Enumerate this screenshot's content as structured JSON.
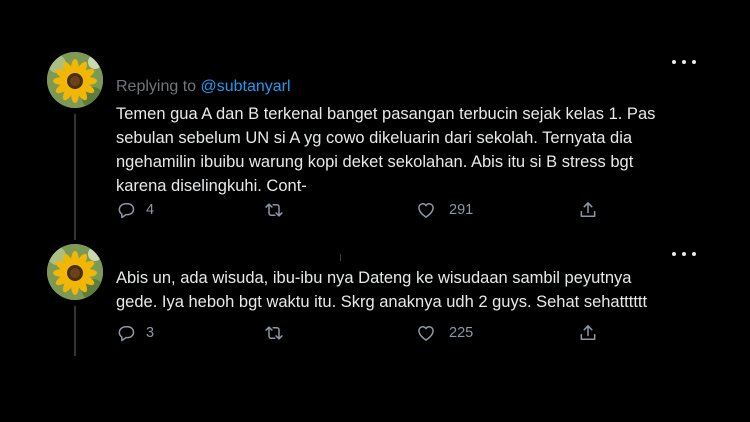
{
  "tweets": [
    {
      "replying_prefix": "Replying to ",
      "replying_handle": "@subtanyarl",
      "text": "Temen gua A dan B terkenal banget pasangan terbucin sejak kelas 1. Pas sebulan sebelum UN si A yg cowo dikeluarin dari sekolah. Ternyata dia ngehamilin ibuibu warung kopi deket sekolahan. Abis itu si B stress bgt karena diselingkuhi. Cont-",
      "replies": "4",
      "retweets": "",
      "likes": "291"
    },
    {
      "text": "Abis un, ada wisuda, ibu-ibu nya Dateng ke wisudaan sambil peyutnya gede. Iya heboh bgt waktu itu. Skrg anaknya udh 2 guys. Sehat sehatttttt",
      "replies": "3",
      "retweets": "",
      "likes": "225"
    }
  ],
  "icons": {
    "reply": "reply-icon",
    "retweet": "retweet-icon",
    "like": "heart-icon",
    "share": "share-icon",
    "more": "more-options-icon",
    "avatar": "sunflower-avatar"
  },
  "colors": {
    "background": "#000000",
    "text": "#e7e9ea",
    "muted": "#71767b",
    "link": "#1d9bf0",
    "thread_line": "#333639"
  }
}
